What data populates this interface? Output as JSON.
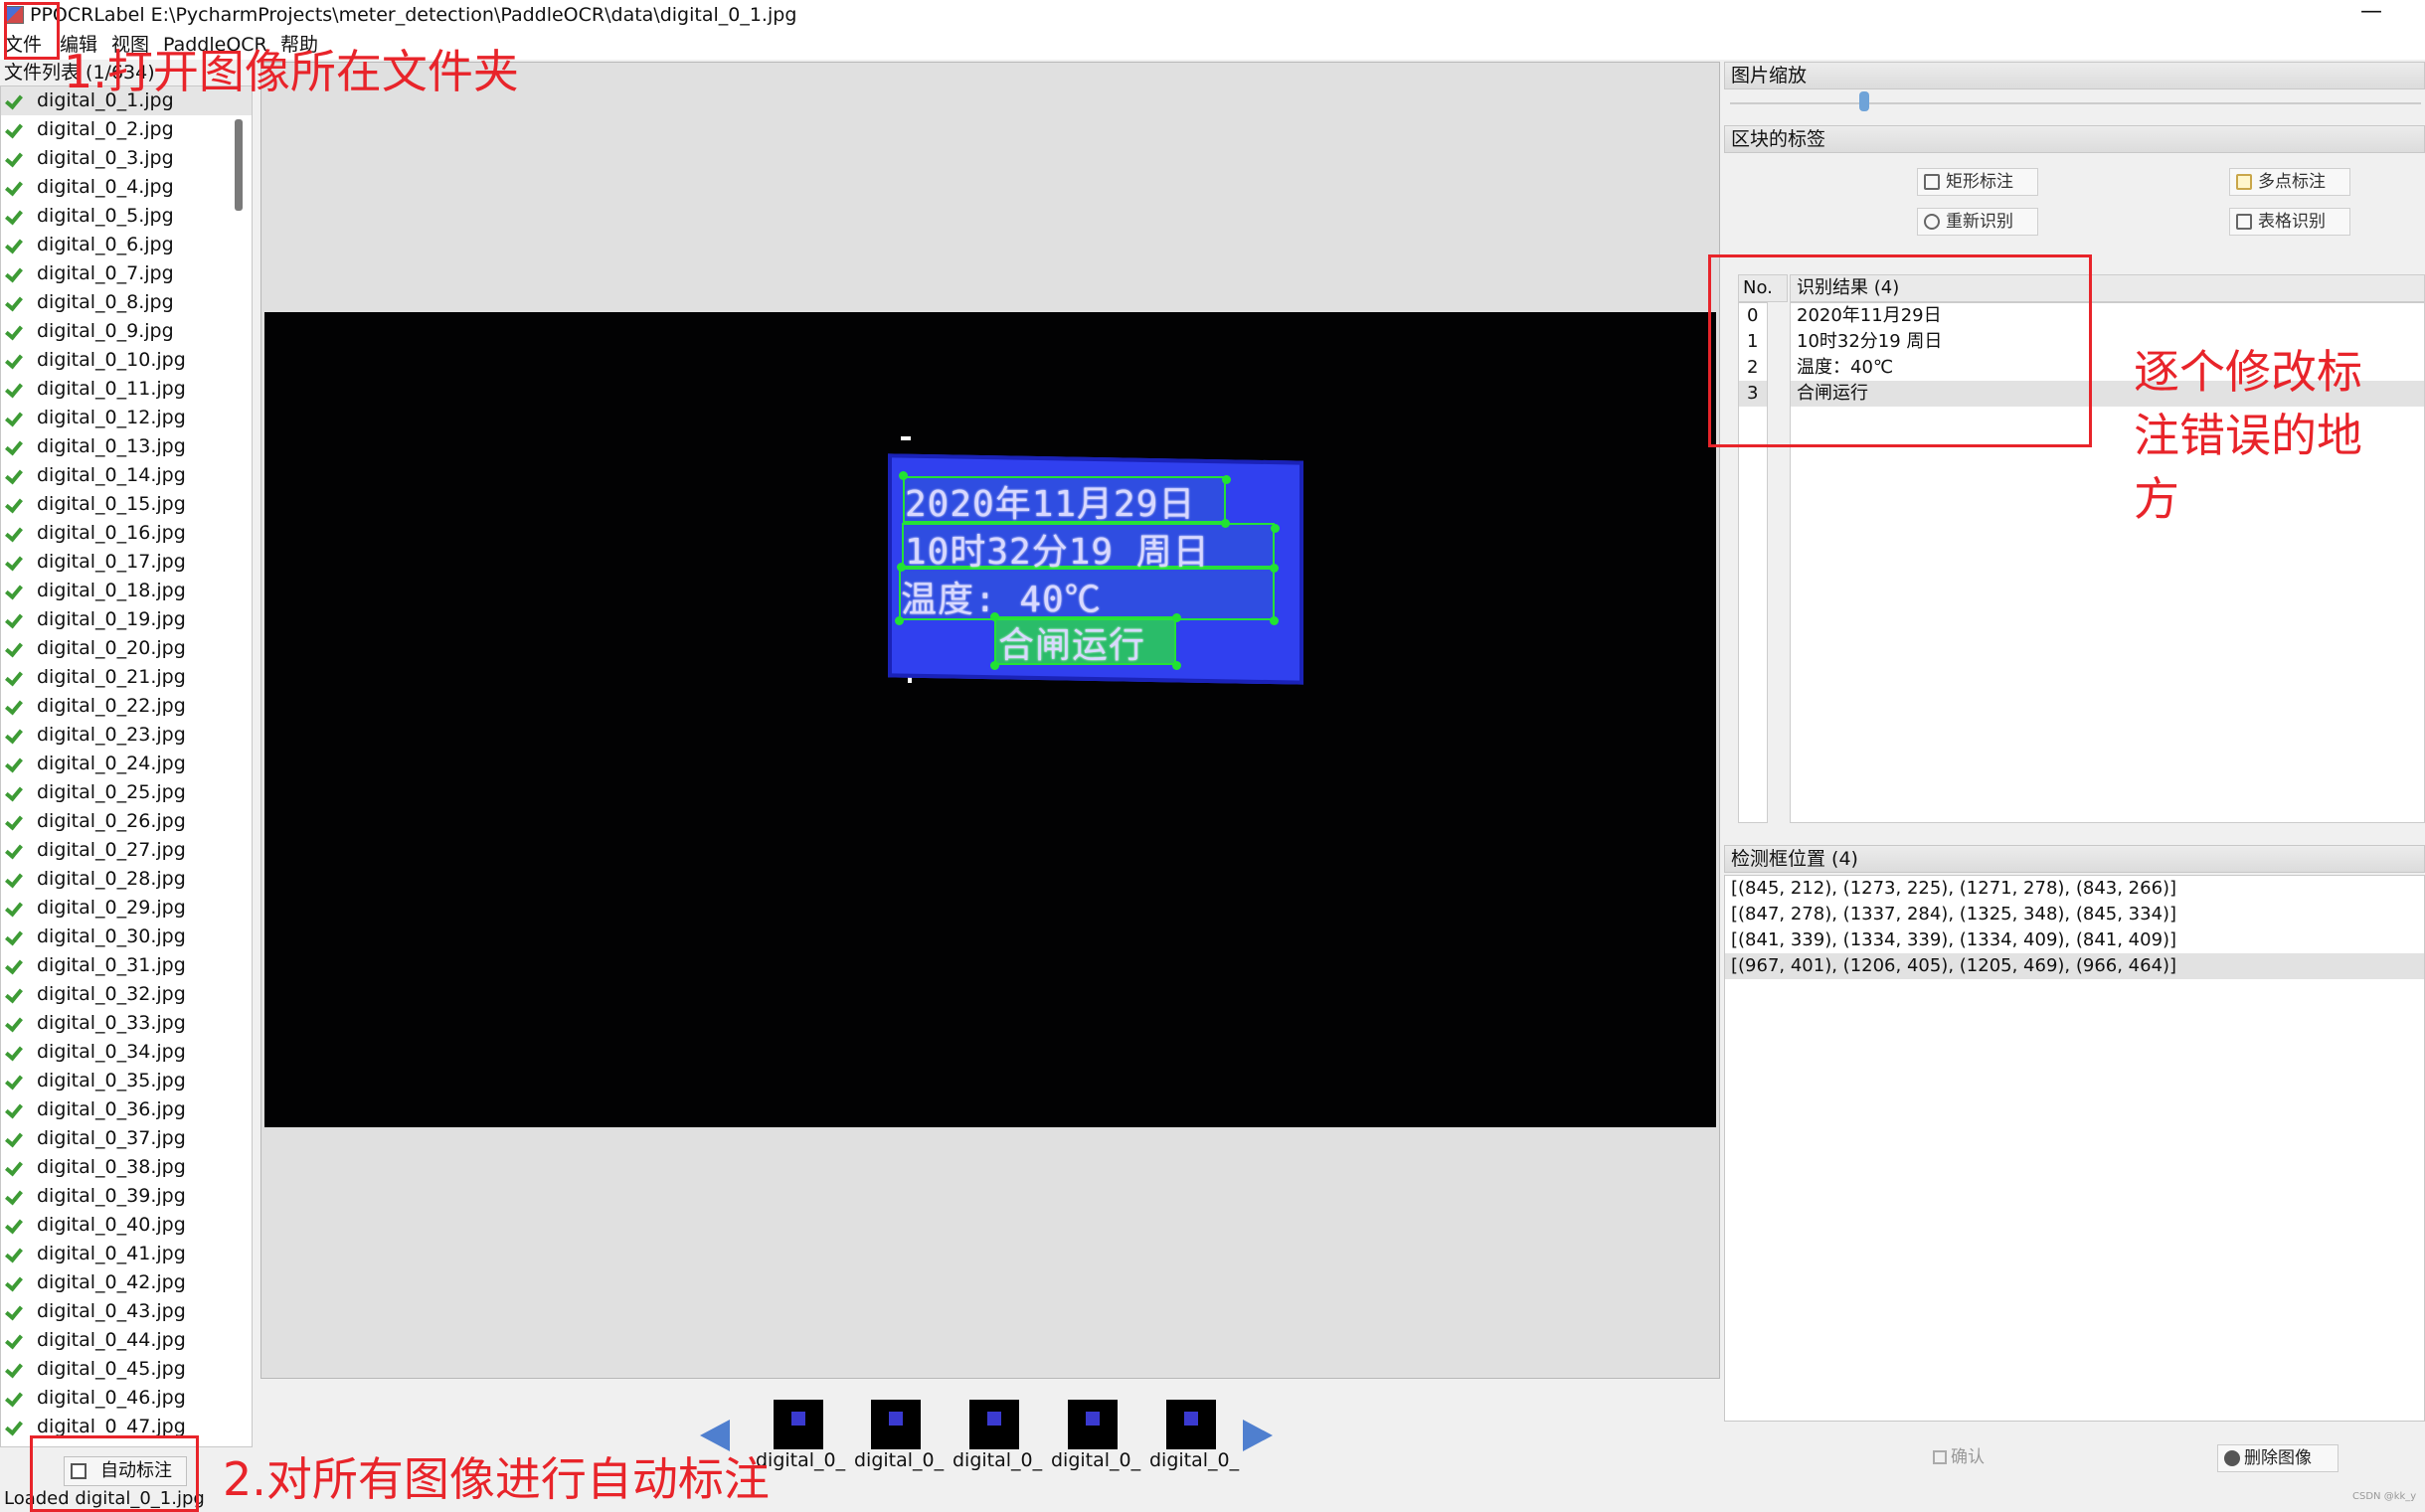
{
  "title": "PPOCRLabel E:\\PycharmProjects\\meter_detection\\PaddleOCR\\data\\digital_0_1.jpg",
  "window_controls": {
    "minimize": "—"
  },
  "menu": [
    "文件",
    "编辑",
    "视图",
    "PaddleOCR",
    "帮助"
  ],
  "file_list": {
    "label": "文件列表 (1/634)",
    "items": [
      "digital_0_1.jpg",
      "digital_0_2.jpg",
      "digital_0_3.jpg",
      "digital_0_4.jpg",
      "digital_0_5.jpg",
      "digital_0_6.jpg",
      "digital_0_7.jpg",
      "digital_0_8.jpg",
      "digital_0_9.jpg",
      "digital_0_10.jpg",
      "digital_0_11.jpg",
      "digital_0_12.jpg",
      "digital_0_13.jpg",
      "digital_0_14.jpg",
      "digital_0_15.jpg",
      "digital_0_16.jpg",
      "digital_0_17.jpg",
      "digital_0_18.jpg",
      "digital_0_19.jpg",
      "digital_0_20.jpg",
      "digital_0_21.jpg",
      "digital_0_22.jpg",
      "digital_0_23.jpg",
      "digital_0_24.jpg",
      "digital_0_25.jpg",
      "digital_0_26.jpg",
      "digital_0_27.jpg",
      "digital_0_28.jpg",
      "digital_0_29.jpg",
      "digital_0_30.jpg",
      "digital_0_31.jpg",
      "digital_0_32.jpg",
      "digital_0_33.jpg",
      "digital_0_34.jpg",
      "digital_0_35.jpg",
      "digital_0_36.jpg",
      "digital_0_37.jpg",
      "digital_0_38.jpg",
      "digital_0_39.jpg",
      "digital_0_40.jpg",
      "digital_0_41.jpg",
      "digital_0_42.jpg",
      "digital_0_43.jpg",
      "digital_0_44.jpg",
      "digital_0_45.jpg",
      "digital_0_46.jpg",
      "digital_0_47.jpg"
    ],
    "selected_index": 0
  },
  "auto_label_button": "自动标注",
  "status": "Loaded digital_0_1.jpg",
  "image_text": {
    "line1": "2020年11月29日",
    "line2": "10时32分19  周日",
    "line3": "温度:      40℃",
    "line4": "合闸运行"
  },
  "thumbnails": [
    "digital_0_",
    "digital_0_",
    "digital_0_",
    "digital_0_",
    "digital_0_"
  ],
  "right_panel": {
    "zoom_title": "图片缩放",
    "zoom_level": 0.19,
    "block_title": "区块的标签",
    "buttons": {
      "rect_label": "矩形标注",
      "poly_label": "多点标注",
      "re_recognize": "重新识别",
      "table_recognize": "表格识别"
    },
    "result_header_no": "No.",
    "result_header_text": "识别结果 (4)",
    "results": [
      {
        "no": "0",
        "text": "2020年11月29日"
      },
      {
        "no": "1",
        "text": "10时32分19 周日"
      },
      {
        "no": "2",
        "text": "温度：40℃"
      },
      {
        "no": "3",
        "text": "合闸运行"
      }
    ],
    "boxes_title": "检测框位置 (4)",
    "boxes": [
      "[(845, 212), (1273, 225), (1271, 278), (843, 266)]",
      "[(847, 278), (1337, 284), (1325, 348), (845, 334)]",
      "[(841, 339), (1334, 339), (1334, 409), (841, 409)]",
      "[(967, 401), (1206, 405), (1205, 469), (966, 464)]"
    ],
    "confirm_button": "确认",
    "delete_button": "删除图像"
  },
  "annotations": {
    "step1": "1.打开图像所在文件夹",
    "step2": "2.对所有图像进行自动标注",
    "step3_line1": "逐个修改标",
    "step3_line2": "注错误的地",
    "step3_line3": "方"
  },
  "watermark": "CSDN @kk_y",
  "colors": {
    "annotation_red": "#e8242a",
    "box_green": "#25e038",
    "lcd_blue": "#3040ef",
    "check_green": "#3d9b35"
  }
}
